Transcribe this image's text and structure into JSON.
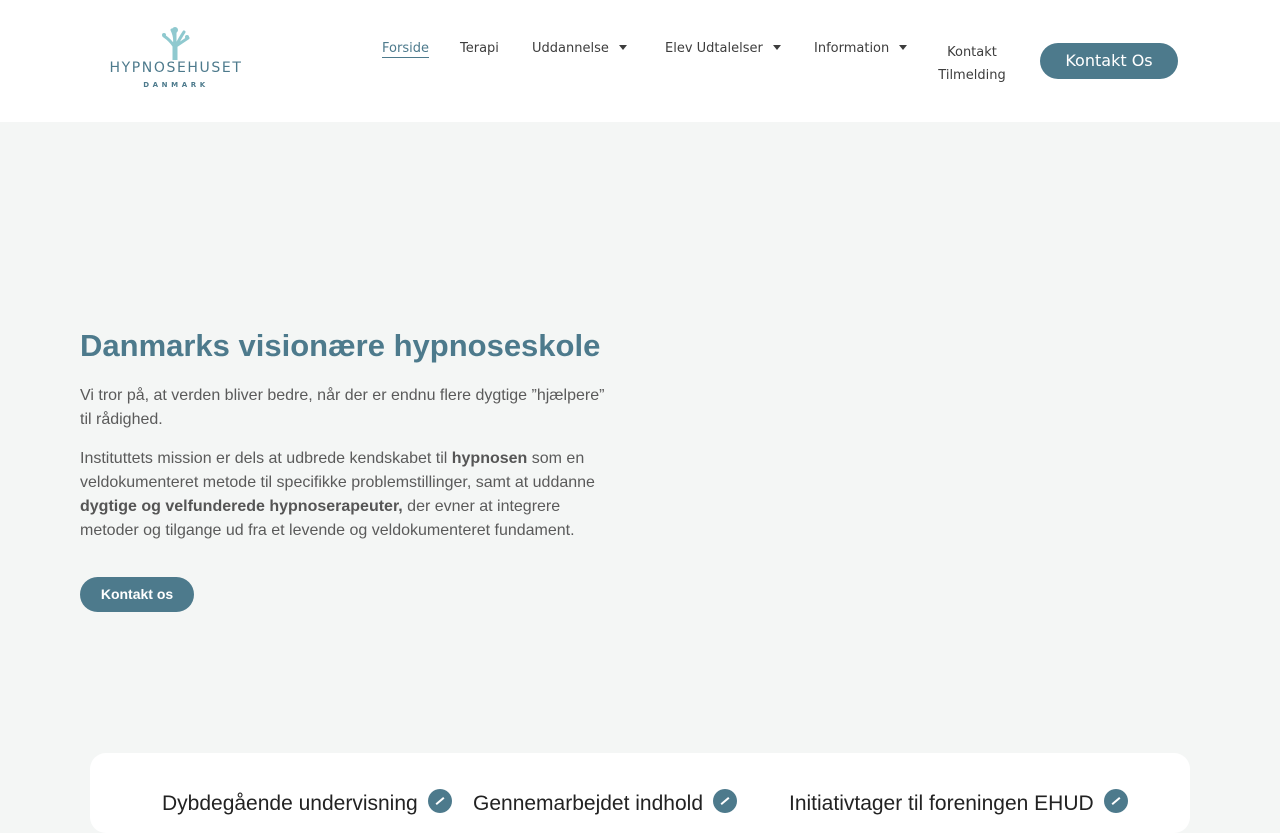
{
  "brand": {
    "name": "HYPNOSEHUSET",
    "sub": "DANMARK"
  },
  "nav": {
    "items": [
      {
        "label": "Forside",
        "active": true
      },
      {
        "label": "Terapi"
      },
      {
        "label": "Uddannelse",
        "dropdown": true
      },
      {
        "label": "Elev Udtalelser",
        "dropdown": true
      },
      {
        "label": "Information",
        "dropdown": true
      }
    ],
    "multi_line": [
      "Kontakt",
      "Tilmelding"
    ],
    "cta": "Kontakt Os"
  },
  "hero": {
    "title": "Danmarks visionære hypnoseskole",
    "p1": "Vi tror på, at verden bliver bedre, når der er endnu flere dygtige ”hjælpere” til rådighed.",
    "p2": {
      "a": "Instituttets mission er dels at udbrede kendskabet til ",
      "b": "hypnosen",
      "c": " som en veldokumenteret metode til specifikke problemstillinger, samt at uddanne ",
      "d": "dygtige og velfunderede hypnoserapeuter,",
      "e": " der evner at integrere metoder og tilgange ud fra et levende og veldokumenteret fundament."
    },
    "button": "Kontakt os"
  },
  "features": [
    {
      "label": "Dybdegående undervisning"
    },
    {
      "label": "Gennemarbejdet indhold"
    },
    {
      "label": "Initiativtager til foreningen EHUD"
    }
  ],
  "colors": {
    "accent": "#4d7a8c",
    "background": "#f4f6f5",
    "header": "#ffffff"
  }
}
